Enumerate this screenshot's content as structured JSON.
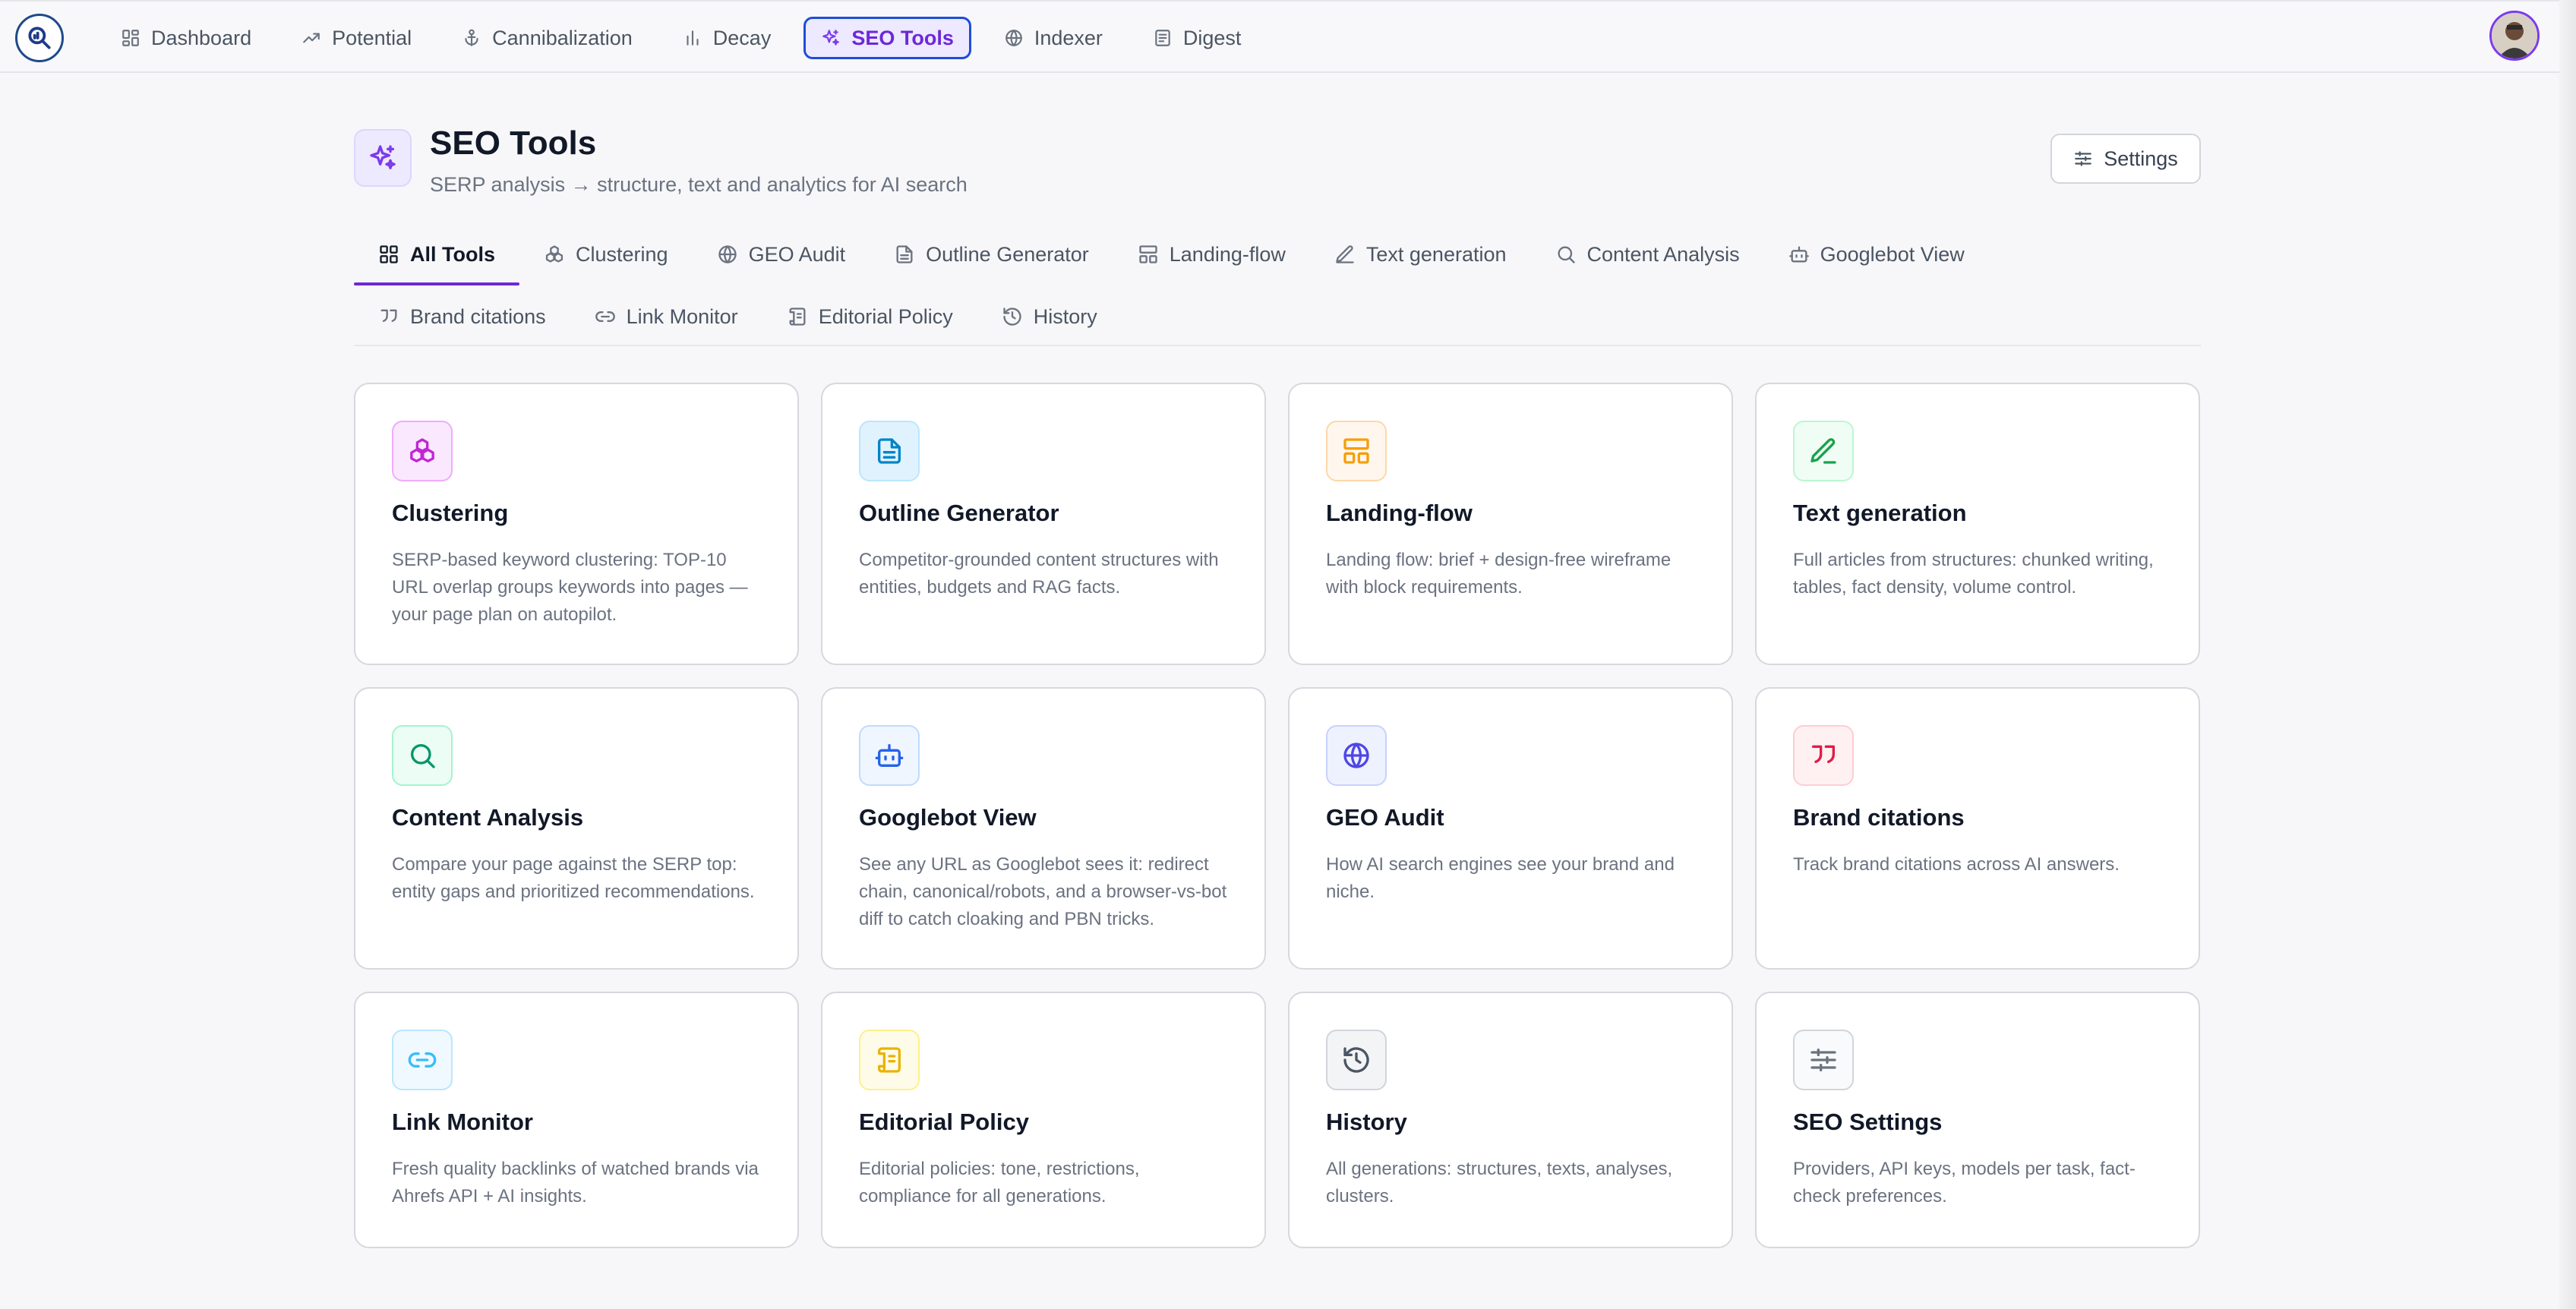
{
  "nav": {
    "items": [
      {
        "label": "Dashboard",
        "icon": "dashboard-icon"
      },
      {
        "label": "Potential",
        "icon": "trending-up-icon"
      },
      {
        "label": "Cannibalization",
        "icon": "anchor-icon"
      },
      {
        "label": "Decay",
        "icon": "bar-chart-icon"
      },
      {
        "label": "SEO Tools",
        "icon": "sparkles-icon",
        "active": true
      },
      {
        "label": "Indexer",
        "icon": "globe-icon"
      },
      {
        "label": "Digest",
        "icon": "newspaper-icon"
      }
    ]
  },
  "header": {
    "title": "SEO Tools",
    "subtitle": "SERP analysis → structure, text and analytics for AI search",
    "settings_label": "Settings"
  },
  "tabs": [
    {
      "label": "All Tools",
      "icon": "grid-icon",
      "active": true
    },
    {
      "label": "Clustering",
      "icon": "boxes-icon"
    },
    {
      "label": "GEO Audit",
      "icon": "globe-icon"
    },
    {
      "label": "Outline Generator",
      "icon": "file-text-icon"
    },
    {
      "label": "Landing-flow",
      "icon": "layout-icon"
    },
    {
      "label": "Text generation",
      "icon": "pen-icon"
    },
    {
      "label": "Content Analysis",
      "icon": "search-icon"
    },
    {
      "label": "Googlebot View",
      "icon": "bot-icon"
    },
    {
      "label": "Brand citations",
      "icon": "quote-icon"
    },
    {
      "label": "Link Monitor",
      "icon": "link-icon"
    },
    {
      "label": "Editorial Policy",
      "icon": "scroll-icon"
    },
    {
      "label": "History",
      "icon": "history-icon"
    }
  ],
  "cards": [
    {
      "title": "Clustering",
      "desc": "SERP-based keyword clustering: TOP-10 URL overlap groups keywords into pages — your page plan on autopilot.",
      "icon": "boxes-icon",
      "color": "#c026d3",
      "bg": "#fae8ff",
      "border": "#f0abfc"
    },
    {
      "title": "Outline Generator",
      "desc": "Competitor-grounded content structures with entities, budgets and RAG facts.",
      "icon": "file-text-icon",
      "color": "#0284c7",
      "bg": "#e0f2fe",
      "border": "#bae6fd"
    },
    {
      "title": "Landing-flow",
      "desc": "Landing flow: brief + design-free wireframe with block requirements.",
      "icon": "layout-icon",
      "color": "#f59e0b",
      "bg": "#fff7ed",
      "border": "#fed7aa"
    },
    {
      "title": "Text generation",
      "desc": "Full articles from structures: chunked writing, tables, fact density, volume control.",
      "icon": "pen-icon",
      "color": "#16a34a",
      "bg": "#f0fdf4",
      "border": "#bbf7d0"
    },
    {
      "title": "Content Analysis",
      "desc": "Compare your page against the SERP top: entity gaps and prioritized recommendations.",
      "icon": "search-icon",
      "color": "#059669",
      "bg": "#ecfdf5",
      "border": "#a7f3d0"
    },
    {
      "title": "Googlebot View",
      "desc": "See any URL as Googlebot sees it: redirect chain, canonical/robots, and a browser-vs-bot diff to catch cloaking and PBN tricks.",
      "icon": "bot-icon",
      "color": "#2563eb",
      "bg": "#eff6ff",
      "border": "#bfdbfe"
    },
    {
      "title": "GEO Audit",
      "desc": "How AI search engines see your brand and niche.",
      "icon": "globe-icon",
      "color": "#4f46e5",
      "bg": "#eef2ff",
      "border": "#c7d2fe"
    },
    {
      "title": "Brand citations",
      "desc": "Track brand citations across AI answers.",
      "icon": "quote-icon",
      "color": "#e11d48",
      "bg": "#fff1f2",
      "border": "#fecdd3"
    },
    {
      "title": "Link Monitor",
      "desc": "Fresh quality backlinks of watched brands via Ahrefs API + AI insights.",
      "icon": "link-icon",
      "color": "#38bdf8",
      "bg": "#f0f9ff",
      "border": "#bae6fd"
    },
    {
      "title": "Editorial Policy",
      "desc": "Editorial policies: tone, restrictions, compliance for all generations.",
      "icon": "scroll-icon",
      "color": "#eab308",
      "bg": "#fefce8",
      "border": "#fef08a"
    },
    {
      "title": "History",
      "desc": "All generations: structures, texts, analyses, clusters.",
      "icon": "history-icon",
      "color": "#4b5563",
      "bg": "#f3f4f6",
      "border": "#d1d5db"
    },
    {
      "title": "SEO Settings",
      "desc": "Providers, API keys, models per task, fact-check preferences.",
      "icon": "sliders-icon",
      "color": "#6b7280",
      "bg": "#f9fafb",
      "border": "#d1d5db"
    }
  ]
}
